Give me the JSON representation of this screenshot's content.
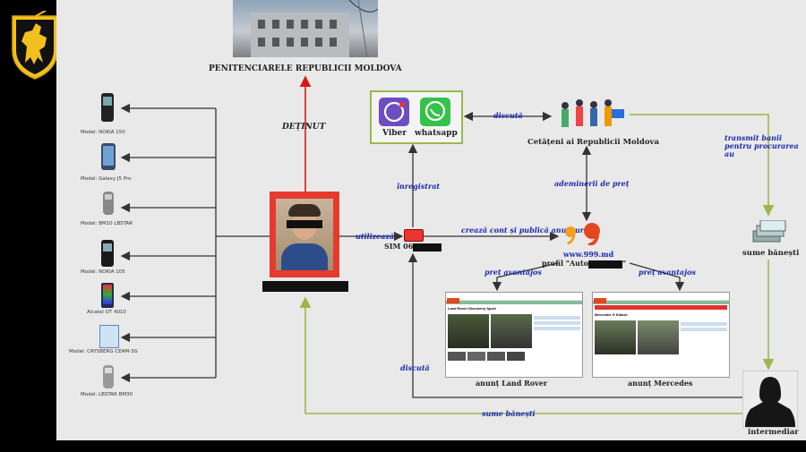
{
  "colors": {
    "background": "#e9e9e9",
    "arrow_dark": "#333333",
    "arrow_red": "#d61a1a",
    "arrow_green": "#9ab84a",
    "label_blue": "#1b2bb0",
    "emblem_gold": "#f2c01e"
  },
  "prison": {
    "title": "PENITENCIARELE REPUBLICII MOLDOVA",
    "edge_label": "DEȚINUT"
  },
  "phones": [
    {
      "model": "Model: NOKIA 150",
      "icon": "black-phone-icon"
    },
    {
      "model": "Model: Galaxy J5 Pro",
      "icon": "smartphone-icon"
    },
    {
      "model": "Model: BM10 LBSTAR",
      "icon": "mini-phone-icon"
    },
    {
      "model": "Model: NOKIA 105",
      "icon": "black-phone-icon"
    },
    {
      "model": "Alcatel OT 4010",
      "icon": "colorful-phone-icon"
    },
    {
      "model": "Model: CRYSBERG CEAM-3G",
      "icon": "blue-phone-icon"
    },
    {
      "model": "Model: LBSTAR BM30",
      "icon": "mini-phone-icon"
    }
  ],
  "apps": {
    "viber": "Viber",
    "whatsapp": "whatsapp"
  },
  "citizens": {
    "title": "Cetățeni ai Republicii Moldova"
  },
  "sim": {
    "label": "SIM 06"
  },
  "site": {
    "url": "www.999.md",
    "profile": "profil \"Auto",
    "profile_end": "\""
  },
  "money": {
    "label": "sume bănești"
  },
  "middleman": {
    "label": "intermediar"
  },
  "ads": {
    "land_rover": "anunț Land Rover",
    "mercedes": "anunț Mercedes",
    "lr_heading": "Land Rover Discovery Sport",
    "merc_heading": "Mercedes G Klasse"
  },
  "edges": {
    "registered": "înregistrat",
    "uses": "utilizează",
    "creates_account": "crează cont și publică anunțuri",
    "discusses_top": "discută",
    "discusses_bottom": "discută",
    "price_agreement": "ademinerii de preț",
    "price_advantage_left": "preț avantajos",
    "price_advantage_right": "preț avantajos",
    "transfers_money": "transmit banii pentru procurarea au",
    "money_bottom": "sume bănești"
  }
}
